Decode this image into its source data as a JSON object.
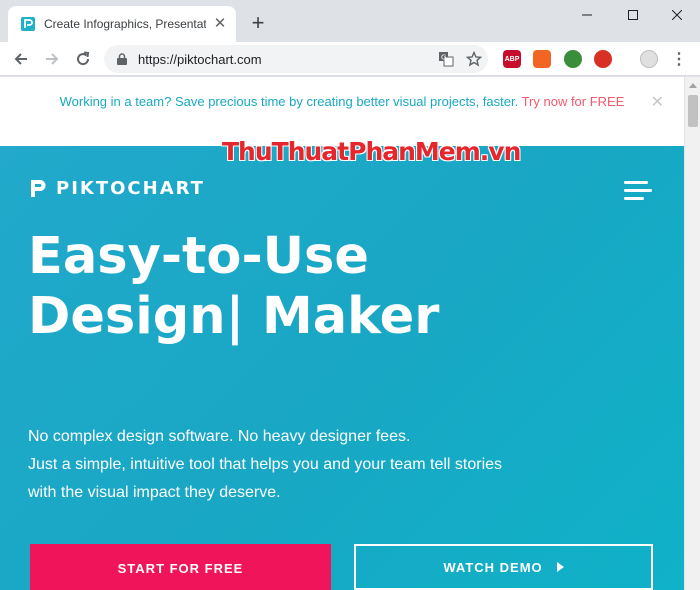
{
  "browser": {
    "tab": {
      "title": "Create Infographics, Presentation",
      "close_glyph": "✕"
    },
    "new_tab_glyph": "+",
    "window_controls": {
      "minimize": "—",
      "maximize": "☐",
      "close": "✕"
    },
    "omnibox": {
      "url": "https://piktochart.com"
    },
    "extensions": [
      {
        "name": "adblock-plus-icon",
        "label": "ABP",
        "color": "#c70d2c"
      },
      {
        "name": "extension-orange-icon",
        "label": "",
        "color": "#f26522"
      },
      {
        "name": "extension-green-icon",
        "label": "",
        "color": "#3a8d3a"
      },
      {
        "name": "extension-red-icon",
        "label": "",
        "color": "#d93025"
      }
    ],
    "menu_glyph": "⋮"
  },
  "page": {
    "banner": {
      "text": "Working in a team? Save precious time by creating better visual projects, faster.",
      "link": "Try now for FREE",
      "close_glyph": "✕"
    },
    "watermark": "ThuThuatPhanMem.vn",
    "logo_text": "PIKTOCHART",
    "headline": {
      "line1": "Easy-to-Use",
      "line2": "Design| Maker"
    },
    "subcopy": {
      "line1": "No complex design software. No heavy designer fees.",
      "line2": "Just a simple, intuitive tool that helps you and your team tell stories",
      "line3": "with the visual impact they deserve."
    },
    "cta_primary": "START FOR FREE",
    "cta_secondary": "WATCH DEMO"
  },
  "colors": {
    "hero_bg": "#18a7c4",
    "banner_text": "#19a8c2",
    "banner_link": "#f05a6e",
    "cta_primary_bg": "#f0145a",
    "watermark": "#e5262c"
  }
}
